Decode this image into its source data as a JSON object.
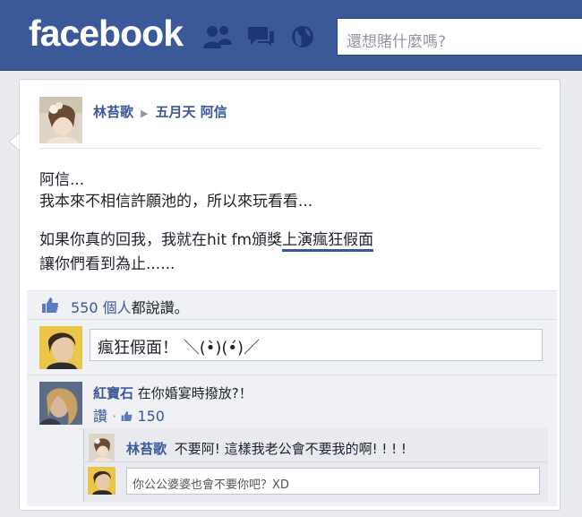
{
  "header": {
    "logo": "facebook",
    "search_placeholder": "還想賭什麼嗎?"
  },
  "post": {
    "author": "林苔歌",
    "target": "五月天 阿信",
    "lines": [
      "阿信...",
      "我本來不相信許願池的，所以來玩看看...",
      "如果你真的回我，我就在hit fm頒獎",
      "上演瘋狂假面",
      "讓你們看到為止......"
    ]
  },
  "likes": {
    "count": "550 個人",
    "suffix": "都說讚。"
  },
  "comment_input": {
    "value": "瘋狂假面！ ＼(•̀)(•́)／"
  },
  "comments": [
    {
      "name": "紅寶石",
      "text": "在你婚宴時撥放?！",
      "like_label": "讚",
      "dot": "·",
      "like_count": "150"
    }
  ],
  "reply": {
    "name": "林苔歌",
    "text": "不要阿! 這樣我老公會不要我的啊! ! ! !"
  },
  "reply_input": {
    "value": "你公公婆婆也會不要你吧？XD"
  },
  "colors": {
    "brand": "#3b5998",
    "link": "#3b5998"
  }
}
